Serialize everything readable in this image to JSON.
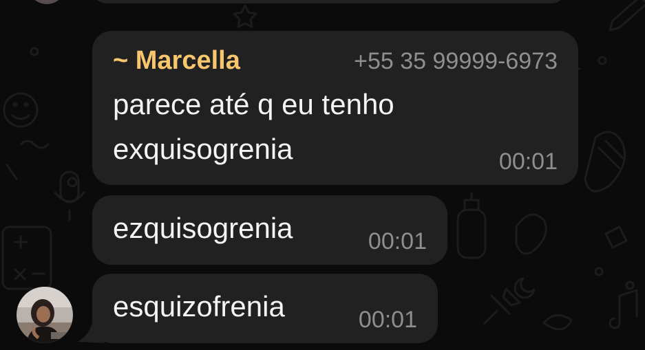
{
  "messages": [
    {
      "sender": "~ Marcella",
      "phone": "+55 35 99999-6973",
      "lines": [
        "parece até q eu tenho",
        "exquisogrenia"
      ],
      "time": "00:01"
    },
    {
      "text": "ezquisogrenia",
      "time": "00:01"
    },
    {
      "text": "esquizofrenia",
      "time": "00:01"
    }
  ],
  "colors": {
    "background": "#0b0b0b",
    "bubble": "#212121",
    "sender_name": "#f8c66d",
    "message_text": "#f4f4f4",
    "meta_text": "#8e8e93"
  },
  "icons": {
    "wallpaper": "doodle-pattern",
    "avatar": "user-avatar-photo"
  }
}
